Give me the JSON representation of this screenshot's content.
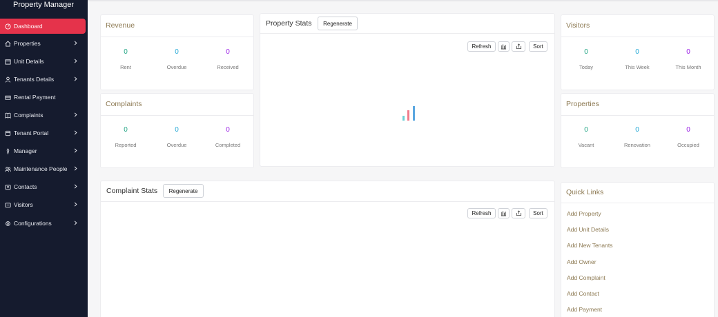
{
  "app": {
    "title": "Property Manager"
  },
  "sidebar": {
    "items": [
      {
        "label": "Dashboard",
        "icon": "dashboard-icon"
      },
      {
        "label": "Properties",
        "icon": "home-icon"
      },
      {
        "label": "Unit Details",
        "icon": "unit-icon"
      },
      {
        "label": "Tenants Details",
        "icon": "user-icon"
      },
      {
        "label": "Rental Payment",
        "icon": "payment-icon"
      },
      {
        "label": "Complaints",
        "icon": "book-icon"
      },
      {
        "label": "Tenant Portal",
        "icon": "portal-icon"
      },
      {
        "label": "Manager",
        "icon": "manager-icon"
      },
      {
        "label": "Maintenance People",
        "icon": "people-icon"
      },
      {
        "label": "Contacts",
        "icon": "contacts-icon"
      },
      {
        "label": "Visitors",
        "icon": "visitors-icon"
      },
      {
        "label": "Configurations",
        "icon": "config-icon"
      }
    ]
  },
  "revenue": {
    "title": "Revenue",
    "stats": [
      {
        "value": "0",
        "label": "Rent"
      },
      {
        "value": "0",
        "label": "Overdue"
      },
      {
        "value": "0",
        "label": "Received"
      }
    ]
  },
  "complaints": {
    "title": "Complaints",
    "stats": [
      {
        "value": "0",
        "label": "Reported"
      },
      {
        "value": "0",
        "label": "Overdue"
      },
      {
        "value": "0",
        "label": "Completed"
      }
    ]
  },
  "property_stats": {
    "title": "Property Stats",
    "regenerate": "Regenerate",
    "refresh": "Refresh",
    "sort": "Sort"
  },
  "visitors": {
    "title": "Visitors",
    "stats": [
      {
        "value": "0",
        "label": "Today"
      },
      {
        "value": "0",
        "label": "This Week"
      },
      {
        "value": "0",
        "label": "This Month"
      }
    ]
  },
  "properties": {
    "title": "Properties",
    "stats": [
      {
        "value": "0",
        "label": "Vacant"
      },
      {
        "value": "0",
        "label": "Renovation"
      },
      {
        "value": "0",
        "label": "Occupied"
      }
    ]
  },
  "complaint_stats": {
    "title": "Complaint Stats",
    "regenerate": "Regenerate",
    "refresh": "Refresh",
    "sort": "Sort"
  },
  "quick_links": {
    "title": "Quick Links",
    "links": [
      "Add Property",
      "Add Unit Details",
      "Add New Tenants",
      "Add Owner",
      "Add Complaint",
      "Add Contact",
      "Add Payment"
    ]
  },
  "colors": {
    "sidebar_bg": "#151b2e",
    "active": "#e5334b",
    "accent_title": "#8d7a53"
  }
}
